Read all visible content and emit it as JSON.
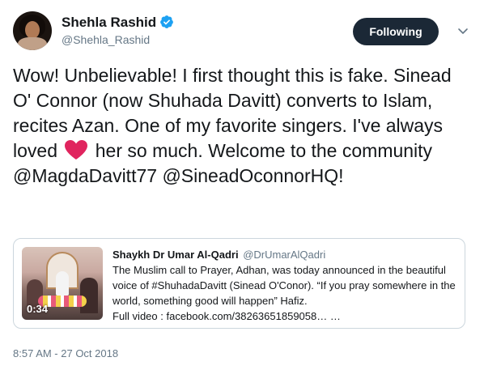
{
  "header": {
    "display_name": "Shehla Rashid",
    "handle": "@Shehla_Rashid",
    "follow_label": "Following"
  },
  "tweet": {
    "text_part1": "Wow! Unbelievable! I first thought this is fake. Sinead O' Connor (now Shuhada Davitt) converts to Islam, recites Azan. One of my favorite singers. I've always loved ",
    "text_part2": " her so much. Welcome to the community ",
    "mention1": "@MagdaDavitt77",
    "mention2": "@SineadOconnorHQ",
    "ending": "!",
    "timestamp": "8:57 AM - 27 Oct 2018"
  },
  "quoted": {
    "author": "Shaykh Dr Umar Al-Qadri",
    "handle": "@DrUmarAlQadri",
    "text": "The Muslim call to Prayer, Adhan, was today announced in the beautiful voice of #ShuhadaDavitt (Sinead O'Conor). “If you pray somewhere in the world, something good will happen” Hafiz.",
    "link": "Full video : facebook.com/38263651859058… …",
    "video_duration": "0:34"
  },
  "colors": {
    "follow_bg": "#1b2836",
    "verified": "#1da1f2",
    "heart": "#e0245e",
    "muted": "#657786"
  },
  "icons": [
    "verified-badge-icon",
    "chevron-down-icon",
    "red-heart-icon"
  ]
}
